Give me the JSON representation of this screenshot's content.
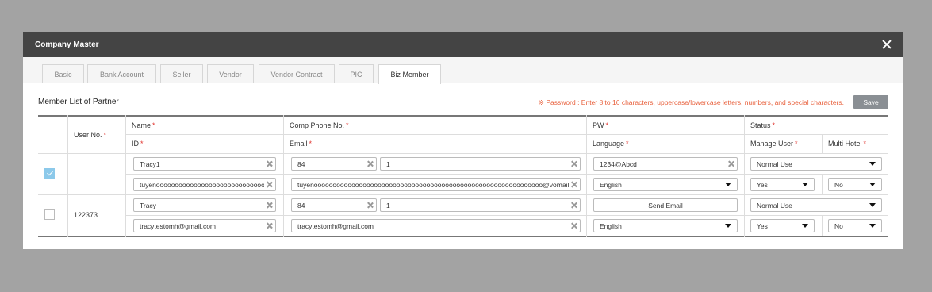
{
  "modal": {
    "title": "Company Master"
  },
  "tabs": [
    {
      "label": "Basic"
    },
    {
      "label": "Bank Account"
    },
    {
      "label": "Seller"
    },
    {
      "label": "Vendor"
    },
    {
      "label": "Vendor Contract"
    },
    {
      "label": "PIC"
    },
    {
      "label": "Biz Member",
      "active": true
    }
  ],
  "section": {
    "title": "Member List of Partner",
    "password_note": "※ Password : Enter 8 to 16 characters, uppercase/lowercase letters, numbers, and special characters.",
    "save_label": "Save"
  },
  "headers": {
    "user_no": "User No.",
    "name": "Name",
    "id": "ID",
    "comp_phone": "Comp Phone No.",
    "email": "Email",
    "pw": "PW",
    "language": "Language",
    "status": "Status",
    "manage_user": "Manage User",
    "multi_hotel": "Multi Hotel",
    "required_mark": "*"
  },
  "rows": [
    {
      "checked": true,
      "user_no": "",
      "name": "Tracy1",
      "id": "tuyenoooooooooooooooooooooooooooooooooooo",
      "phone_code": "84",
      "phone_number": "1",
      "email": "tuyenooooooooooooooooooooooooooooooooooooooooooooooooooooooooooooo@vomail.com",
      "pw": "1234@Abcd",
      "language": "English",
      "status": "Normal Use",
      "manage_user": "Yes",
      "multi_hotel": "No"
    },
    {
      "checked": false,
      "user_no": "122373",
      "name": "Tracy",
      "id": "tracytestomh@gmail.com",
      "phone_code": "84",
      "phone_number": "1",
      "email": "tracytestomh@gmail.com",
      "pw_button": "Send Email",
      "language": "English",
      "status": "Normal Use",
      "manage_user": "Yes",
      "multi_hotel": "No"
    }
  ],
  "colors": {
    "header_bg": "#444444",
    "note_text": "#e8603c",
    "required": "#e0312b",
    "checkbox_checked": "#8cc9ea",
    "save_button": "#8a8f94"
  }
}
